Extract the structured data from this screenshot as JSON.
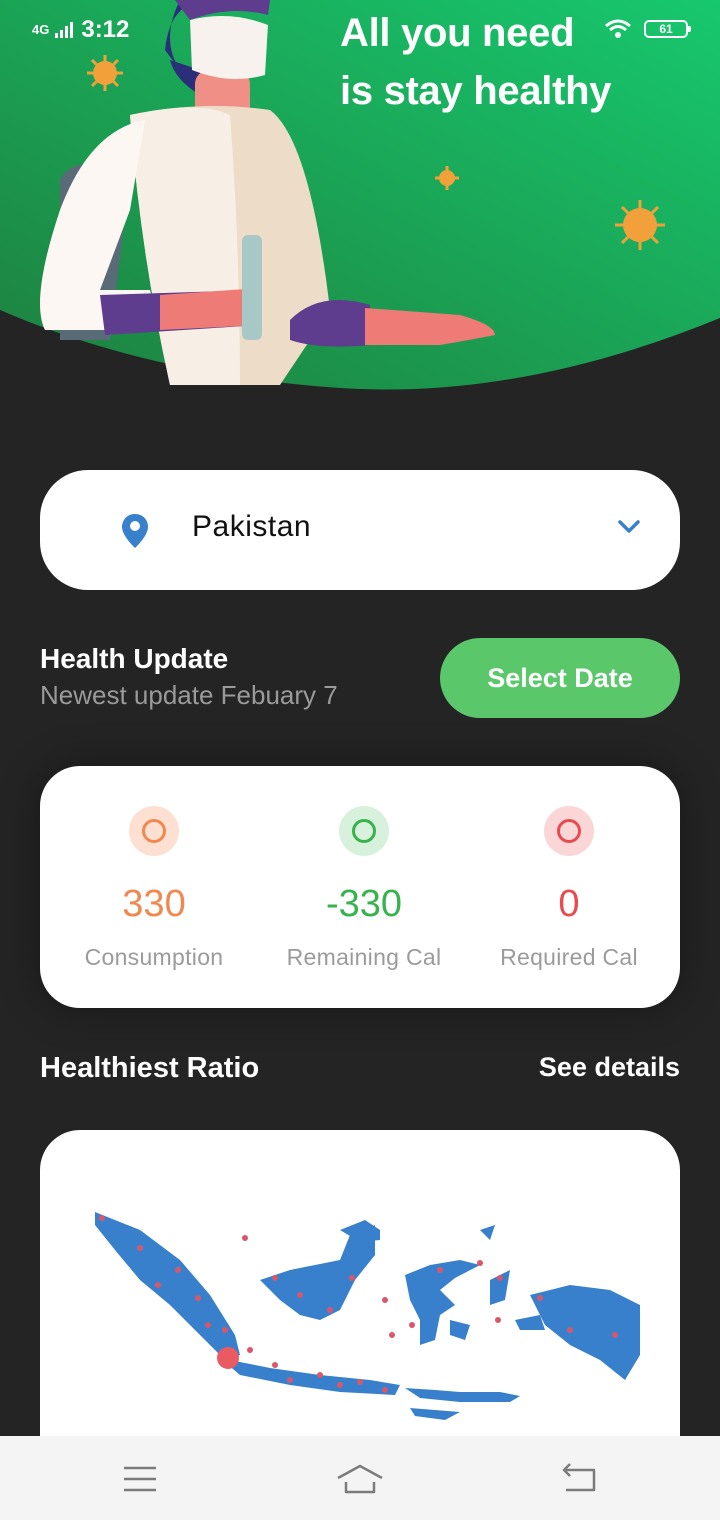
{
  "status_bar": {
    "network": "4G",
    "time": "3:12",
    "battery": "61"
  },
  "hero": {
    "headline_line1": "All you need",
    "headline_line2": "is stay healthy"
  },
  "country_selector": {
    "value": "Pakistan",
    "icon": "location-pin-icon",
    "dropdown_icon": "chevron-down-icon"
  },
  "health_update": {
    "title": "Health Update",
    "subtitle": "Newest update Febuary 7",
    "select_date_label": "Select Date"
  },
  "stats": [
    {
      "value": "330",
      "label": "Consumption",
      "color": "#f0884f",
      "bg": "#fde0d2"
    },
    {
      "value": "-330",
      "label": "Remaining Cal",
      "color": "#37b24d",
      "bg": "#d8f1dc"
    },
    {
      "value": "0",
      "label": "Required Cal",
      "color": "#e84a4f",
      "bg": "#fbd6d6"
    }
  ],
  "healthiest_ratio": {
    "title": "Healthiest Ratio",
    "see_details": "See details"
  },
  "colors": {
    "hero_green": "#16c46c",
    "accent_green": "#5ac86a",
    "map_blue": "#3880cc",
    "pin_blue": "#3880cc"
  },
  "navbar": {
    "icons": [
      "menu-icon",
      "home-icon",
      "back-icon"
    ]
  }
}
